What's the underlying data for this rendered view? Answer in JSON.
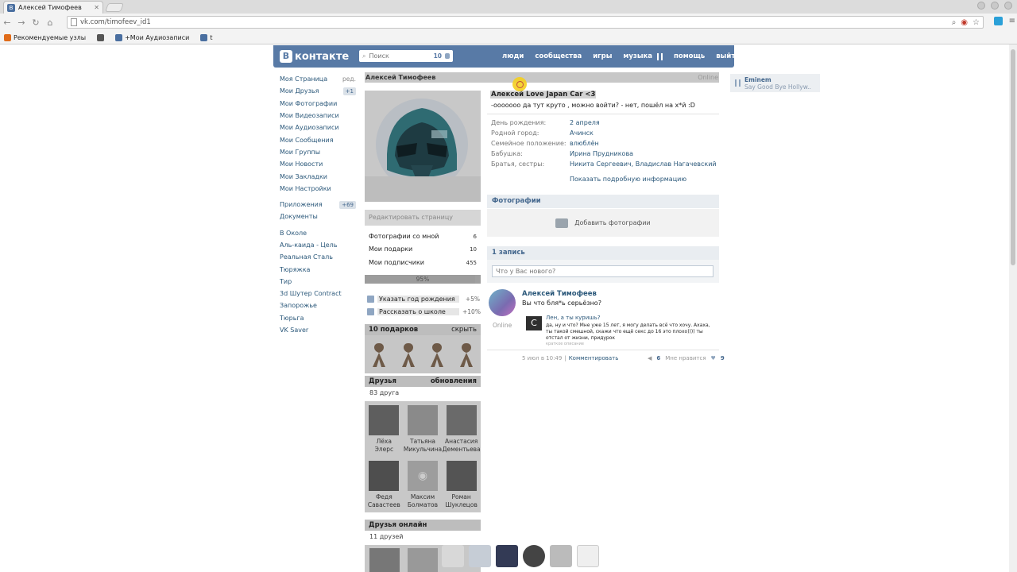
{
  "browser": {
    "tab_title": "Алексей Тимофеев",
    "url": "vk.com/timofeev_id1",
    "bookmarks": [
      {
        "label": "Рекомендуемые узлы",
        "color": "#e06c1a"
      },
      {
        "label": "",
        "color": "#555555"
      },
      {
        "label": "+Мои Аудиозаписи",
        "color": "#4a6fa0"
      },
      {
        "label": "t",
        "color": "#4a6fa0"
      }
    ]
  },
  "header": {
    "logo_text": "контакте",
    "logo_letter": "В",
    "search_placeholder": "Поиск",
    "search_count": "10",
    "nav": [
      "люди",
      "сообщества",
      "игры",
      "музыка",
      "помощь",
      "выйти"
    ],
    "accent_color": "#587aa6"
  },
  "left_menu": {
    "edit_label": "ред.",
    "items": [
      {
        "label": "Моя Страница",
        "badge": ""
      },
      {
        "label": "Мои Друзья",
        "badge": "+1"
      },
      {
        "label": "Мои Фотографии",
        "badge": ""
      },
      {
        "label": "Мои Видеозаписи",
        "badge": ""
      },
      {
        "label": "Мои Аудиозаписи",
        "badge": ""
      },
      {
        "label": "Мои Сообщения",
        "badge": ""
      },
      {
        "label": "Мои Группы",
        "badge": ""
      },
      {
        "label": "Мои Новости",
        "badge": ""
      },
      {
        "label": "Мои Закладки",
        "badge": ""
      },
      {
        "label": "Мои Настройки",
        "badge": ""
      }
    ],
    "apps": [
      {
        "label": "Приложения",
        "badge": "+69"
      },
      {
        "label": "Документы",
        "badge": ""
      }
    ],
    "extras": [
      "В Околе",
      "Аль-каида - Цель",
      "Реальная Сталь",
      "Тюряжка",
      "Тир",
      "3d Шутер Contract",
      "Запорожье",
      "Тюрьга",
      "VK Saver"
    ]
  },
  "profile": {
    "name": "Алексей Тимофеев",
    "online": "Online",
    "edit_page": "Редактировать страницу",
    "side_links": [
      {
        "label": "Фотографии со мной",
        "count": "6"
      },
      {
        "label": "Мои подарки",
        "count": "10"
      },
      {
        "label": "Мои подписчики",
        "count": "455"
      }
    ],
    "completeness": "95%",
    "completeness_value": 0.95,
    "todo": [
      {
        "label": "Указать год рождения",
        "pct": "+5%"
      },
      {
        "label": "Рассказать о школе",
        "pct": "+10%"
      }
    ],
    "gifts_title": "10 подарков",
    "gifts_hide": "скрыть",
    "friends_title": "Друзья",
    "friends_updates": "обновления",
    "friends_count": "83 друга",
    "friends": [
      {
        "name": "Лёха\nЭлерс",
        "photo": true
      },
      {
        "name": "Татьяна\nМикульчина",
        "photo": true
      },
      {
        "name": "Анастасия\nДементьева",
        "photo": true
      },
      {
        "name": "Федя\nСавастеев",
        "photo": true
      },
      {
        "name": "Максим\nБолматов",
        "photo": false
      },
      {
        "name": "Роман\nШуклецов",
        "photo": true
      }
    ],
    "online_title": "Друзья онлайн",
    "online_count": "11 друзей"
  },
  "main": {
    "status_name": "Алексей Love Japan Car <3",
    "status_text": "-ooooooo да тут круто , можно войти? - нет, пошёл на х*й :D",
    "info": [
      {
        "k": "День рождения:",
        "v": "2 апреля"
      },
      {
        "k": "Родной город:",
        "v": "Ачинск"
      },
      {
        "k": "Семейное положение:",
        "v": "влюблён"
      },
      {
        "k": "Бабушка:",
        "v": "Ирина Прудникова"
      },
      {
        "k": "Братья, сестры:",
        "v": "Никита Сергеевич, Владислав Нагачевский"
      }
    ],
    "show_more": "Показать подробную информацию",
    "photos_title": "Фотографии",
    "add_photos": "Добавить фотографии",
    "wall_title": "1 запись",
    "wall_placeholder": "Что у Вас нового?",
    "post": {
      "author": "Алексей Тимофеев",
      "text": "Вы что бля*ь серьёзно?",
      "online": "Online",
      "repost_title": "Лен, а ты куришь?",
      "repost_text": "да, ну и что? Мне уже 15 лет, я могу делать всё что хочу. Ахаха, ты такой смешной, скажи что ещё секс до 16 это плохо)))) ты отстал от жизни, придурок",
      "repost_sub": "краткое описание",
      "date": "5 июл в 10:49",
      "comment": "Комментировать",
      "reposts": "6",
      "like_label": "Мне нравится",
      "likes": "9"
    }
  },
  "player": {
    "artist": "Eminem",
    "title": "Say Good Bye Hollyw..."
  }
}
